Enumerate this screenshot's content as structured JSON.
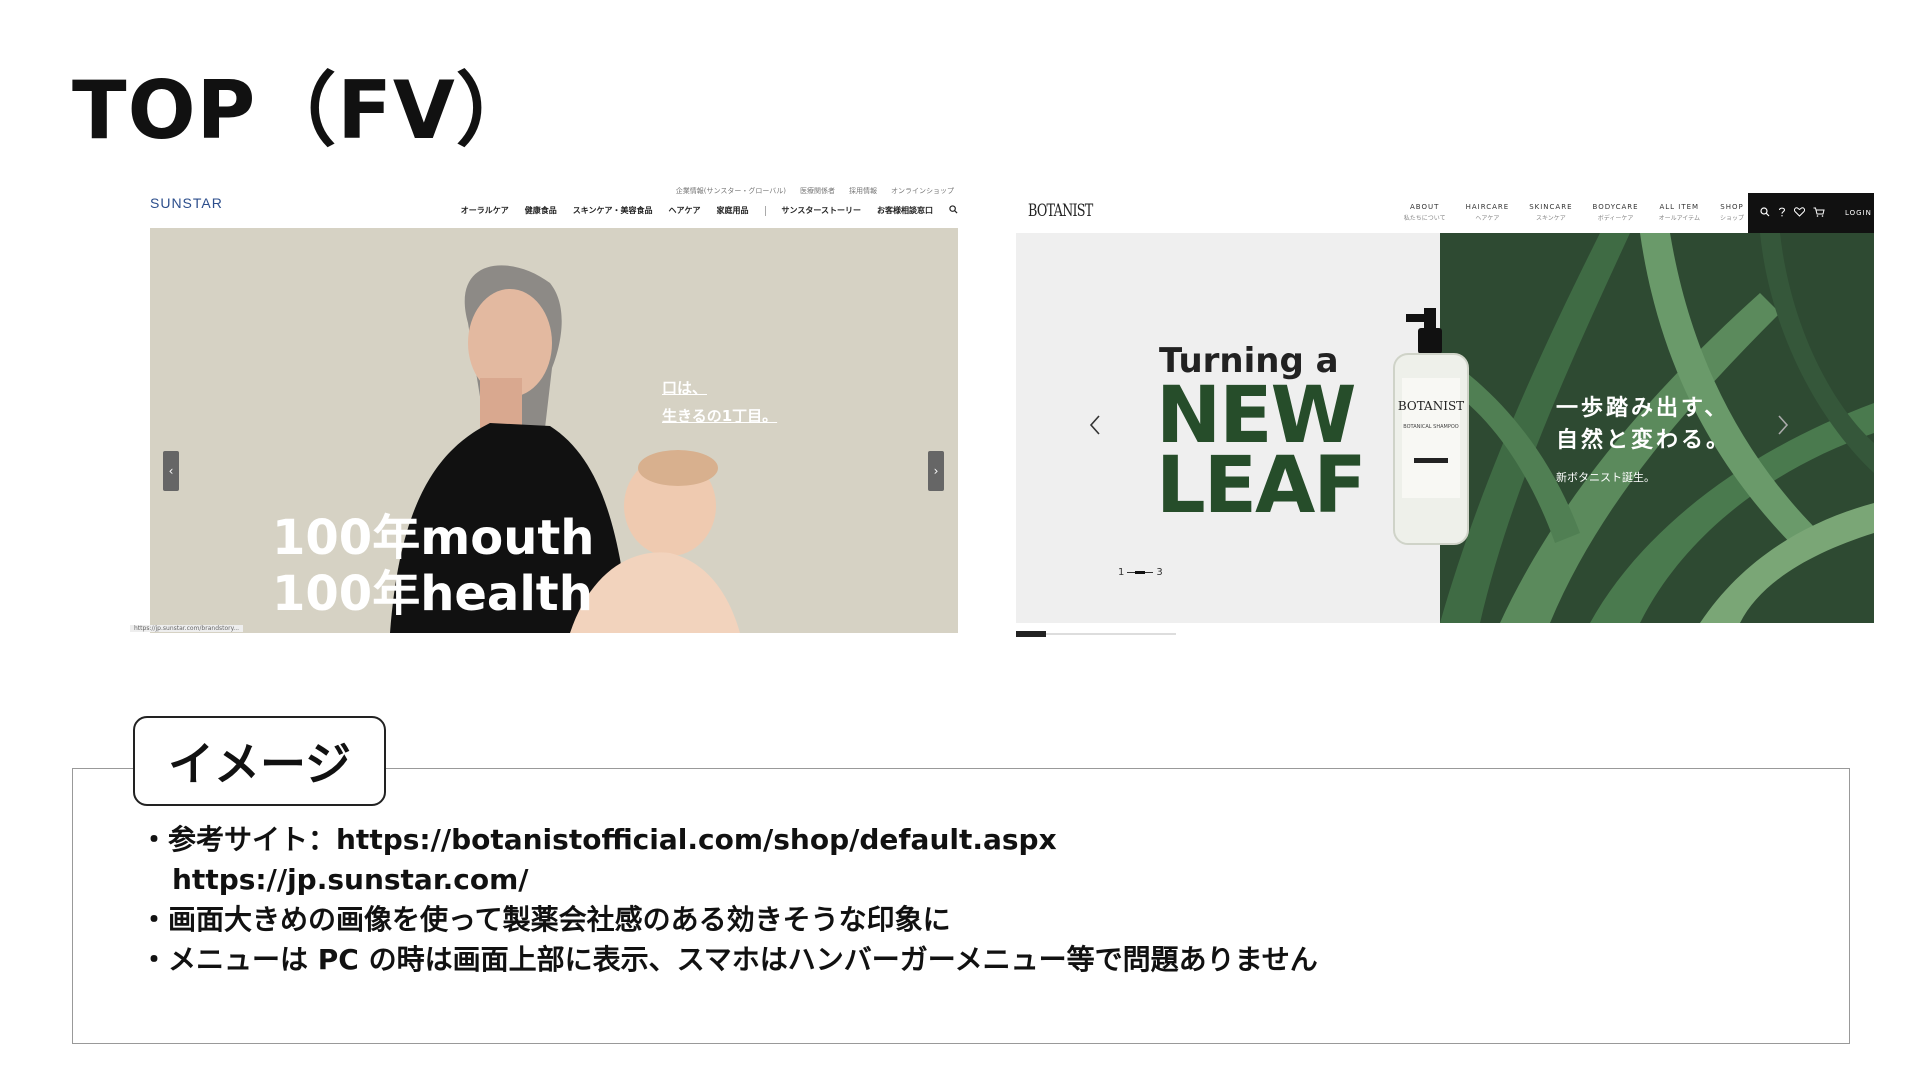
{
  "slide": {
    "title": "TOP（FV）"
  },
  "sunstar": {
    "logo": "SUNSTAR",
    "utility_links": [
      "企業情報(サンスター・グローバル)",
      "医療関係者",
      "採用情報",
      "オンラインショップ"
    ],
    "nav": [
      "オーラルケア",
      "健康食品",
      "スキンケア・美容食品",
      "ヘアケア",
      "家庭用品",
      "サンスターストーリー",
      "お客様相談窓口"
    ],
    "hero_copy": [
      "口は、",
      "生きるの1丁目。"
    ],
    "hero_big": [
      "100年mouth",
      "100年health"
    ],
    "prev_arrow": "‹",
    "next_arrow": "›",
    "status_url": "https://jp.sunstar.com/brandstory..."
  },
  "botanist": {
    "logo": "BOTANIST",
    "nav": [
      {
        "en": "ABOUT",
        "jp": "私たちについて"
      },
      {
        "en": "HAIRCARE",
        "jp": "ヘアケア"
      },
      {
        "en": "SKINCARE",
        "jp": "スキンケア"
      },
      {
        "en": "BODYCARE",
        "jp": "ボディーケア"
      },
      {
        "en": "ALL ITEM",
        "jp": "オールアイテム"
      },
      {
        "en": "SHOP",
        "jp": "ショップ"
      }
    ],
    "login": "LOGIN",
    "hero_turning": "Turning a",
    "hero_newleaf": [
      "NEW",
      "LEAF"
    ],
    "hero_jp": [
      "一歩踏み出す、",
      "自然と変わる。"
    ],
    "hero_sub": "新ボタニスト誕生。",
    "pager_start": "1",
    "pager_end": "3",
    "bottle_brand": "BOTANIST",
    "bottle_sub": "BOTANICAL SHAMPOO"
  },
  "note": {
    "tab": "イメージ",
    "lines": [
      "・参考サイト：https://botanistofficial.com/shop/default.aspx",
      "https://jp.sunstar.com/",
      "・画面大きめの画像を使って製薬会社感のある効きそうな印象に",
      "・メニューは PC の時は画面上部に表示、スマホはハンバーガーメニュー等で問題ありません"
    ]
  }
}
